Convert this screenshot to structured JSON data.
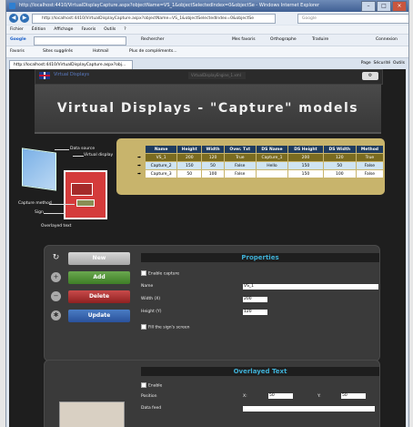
{
  "browser": {
    "title": "http://localhost:4410/VirtualDisplayCapture.aspx?objectName=VS_1&objectSelectedIndex=0&objectSe - Windows Internet Explorer",
    "url": "http://localhost:4410/VirtualDisplayCapture.aspx?objectName=VS_1&objectSelectedIndex=0&objectSe",
    "search_placeholder": "Google",
    "menu": [
      "Fichier",
      "Édition",
      "Affichage",
      "Favoris",
      "Outils",
      "?"
    ],
    "google_label": "Google",
    "google_tools": [
      "Rechercher",
      "Mes favoris",
      "Orthographe",
      "Traduire",
      "Connexion"
    ],
    "favorites_label": "Favoris",
    "favorites_items": [
      "Sites suggérés",
      "Hotmail",
      "Plus de compléments..."
    ],
    "tab_label": "http://localhost:4410/VirtualDisplayCapture.aspx?obj...",
    "tab_tools": [
      "Page",
      "Sécurité",
      "Outils"
    ]
  },
  "site": {
    "lang_label": "Virtual Displays",
    "strip_box": "VirtualDisplayEngine_1.xml",
    "header": "Virtual Displays - \"Capture\" models"
  },
  "diagram": {
    "labels": [
      "Data source",
      "Virtual display",
      "Capture method",
      "Sign",
      "Overlayed text"
    ]
  },
  "table": {
    "headers": [
      "Name",
      "Height",
      "Width",
      "Over. Txt",
      "DS Name",
      "DS Height",
      "DS Width",
      "Method"
    ],
    "rows": [
      [
        "VS_1",
        "200",
        "120",
        "True",
        "Capture_1",
        "200",
        "120",
        "True"
      ],
      [
        "Capture_2",
        "150",
        "50",
        "False",
        "Hello",
        "150",
        "50",
        "False"
      ],
      [
        "Capture_3",
        "50",
        "100",
        "False",
        "",
        "150",
        "100",
        "False"
      ]
    ]
  },
  "actions": {
    "new": "New",
    "add": "Add",
    "delete": "Delete",
    "update": "Update"
  },
  "properties": {
    "title": "Properties",
    "enable_capture": "Enable capture",
    "name_label": "Name",
    "name_value": "VS_1",
    "width_label": "Width (X)",
    "width_value": "200",
    "height_label": "Height (Y)",
    "height_value": "120",
    "fill_label": "Fill the sign's screen"
  },
  "overlay": {
    "title": "Overlayed Text",
    "enable": "Enable",
    "position_label": "Position",
    "x_label": "X:",
    "x_value": "50",
    "y_label": "Y:",
    "y_value": "50",
    "datafeed_label": "Data feed"
  }
}
